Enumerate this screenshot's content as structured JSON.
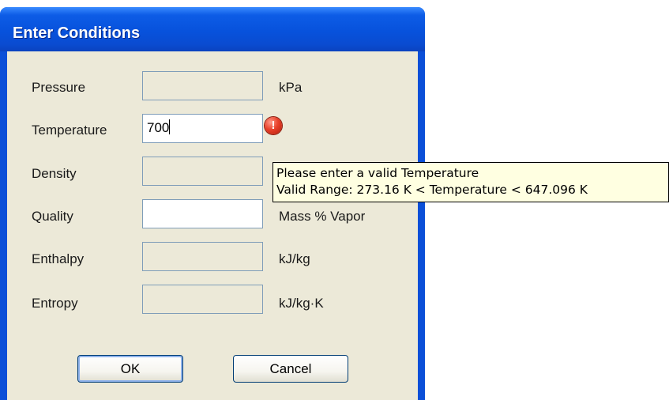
{
  "window": {
    "title": "Enter Conditions"
  },
  "form": {
    "fields": [
      {
        "label": "Pressure",
        "value": "",
        "unit": "kPa"
      },
      {
        "label": "Temperature",
        "value": "700",
        "unit": ""
      },
      {
        "label": "Density",
        "value": "",
        "unit": ""
      },
      {
        "label": "Quality",
        "value": "",
        "unit": "Mass % Vapor"
      },
      {
        "label": "Enthalpy",
        "value": "",
        "unit": "kJ/kg"
      },
      {
        "label": "Entropy",
        "value": "",
        "unit": "kJ/kg·K"
      }
    ],
    "error_icon_glyph": "!"
  },
  "buttons": {
    "ok": "OK",
    "cancel": "Cancel"
  },
  "tooltip": {
    "line1": "Please enter a valid Temperature",
    "line2": "Valid Range: 273.16 K < Temperature < 647.096 K"
  },
  "colors": {
    "titlebar": "#0752dc",
    "dialog_bg": "#ece9d8",
    "tooltip_bg": "#ffffe1",
    "error_icon": "#e8402a"
  },
  "icons": {
    "error": "exclamation-error-icon"
  }
}
